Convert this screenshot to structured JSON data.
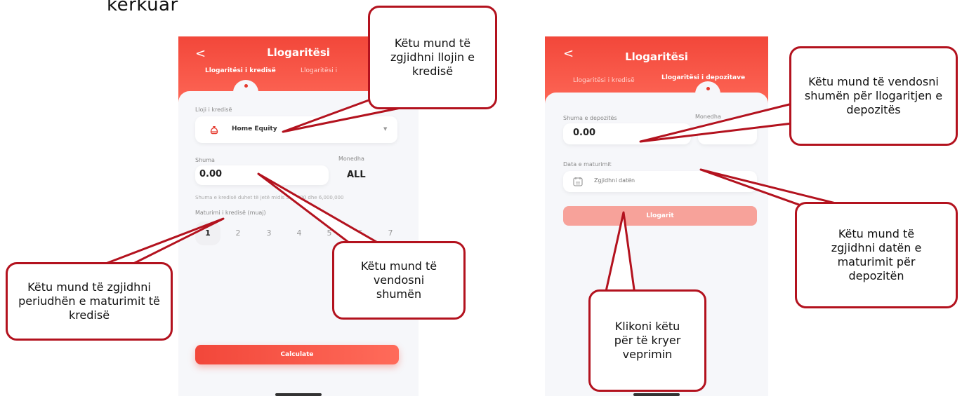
{
  "top_fragment": "kërkuar",
  "phone1": {
    "back": "<",
    "title": "Llogaritësi",
    "tab_active": "Llogaritësi i kredisë",
    "tab_inactive": "Llogaritësi i",
    "loan_type_label": "Lloji i kredisë",
    "loan_type_value": "Home Equity",
    "amount_label": "Shuma",
    "amount_value": "0.00",
    "currency_label": "Monedha",
    "currency_value": "ALL",
    "hint": "Shuma e kredisë duhet të jetë midis 500,000 dhe 6,000,000",
    "maturity_label": "Maturimi i kredisë (muaj)",
    "months": [
      "1",
      "2",
      "3",
      "4",
      "5",
      "6",
      "7"
    ],
    "selected_month": "1",
    "calculate": "Calculate"
  },
  "phone2": {
    "back": "<",
    "title": "Llogaritësi",
    "tab_inactive": "Llogaritësi i kredisë",
    "tab_active": "Llogaritësi i depozitave",
    "amount_label": "Shuma e depozitës",
    "amount_value": "0.00",
    "currency_label": "Monedha",
    "maturity_label": "Data e maturimit",
    "date_placeholder": "Zgjidhni datën",
    "calculate": "Llogarit"
  },
  "callouts": {
    "loan_type": "Këtu mund të zgjidhni llojin e kredisë",
    "maturity": "Këtu mund të zgjidhni periudhën e maturimit të kredisë",
    "amount": "Këtu mund të vendosni shumën",
    "deposit_amount": "Këtu mund të vendosni shumën për llogaritjen e depozitës",
    "deposit_date": "Këtu mund të zgjidhni datën e maturimit për depozitën",
    "execute": "Klikoni këtu për të kryer veprimin"
  },
  "colors": {
    "accent": "#f2473a",
    "callout_border": "#b3121e"
  }
}
